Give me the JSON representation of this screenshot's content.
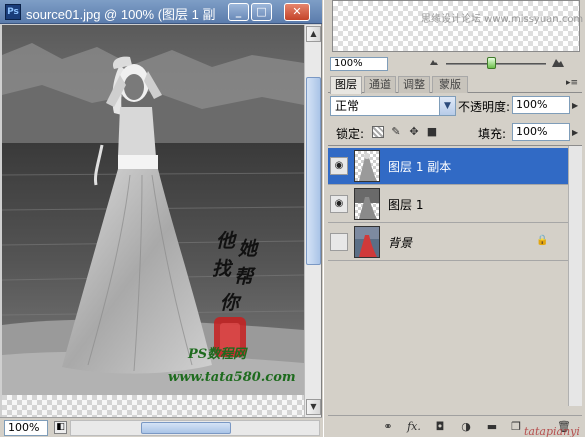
{
  "document": {
    "ps_badge": "Ps",
    "title": "source01.jpg @ 100% (图层 1 副",
    "controls": {
      "minimize": "_",
      "maximize": "□",
      "close": "✕"
    },
    "zoom": "100%",
    "artwork": {
      "calligraphy": [
        "他",
        "她",
        "找",
        "帮",
        "你"
      ],
      "site_brand": "PS数程网",
      "site_url": "www.tata580.com"
    }
  },
  "navigator": {
    "watermark": "思缘设计论坛  www.missyuan.com",
    "zoom": "100%",
    "zoom_level": 0.45
  },
  "layers_panel": {
    "tabs": [
      {
        "label": "图层",
        "active": true
      },
      {
        "label": "通道",
        "active": false
      },
      {
        "label": "调整",
        "active": false
      },
      {
        "label": "蒙版",
        "active": false
      }
    ],
    "menu_icon": "▸≡",
    "blend_mode": "正常",
    "opacity_label": "不透明度:",
    "opacity": "100%",
    "lock_label": "锁定:",
    "fill_label": "填充:",
    "fill": "100%",
    "layers": [
      {
        "name": "图层 1 副本",
        "visible": true,
        "selected": true,
        "locked": false
      },
      {
        "name": "图层 1",
        "visible": true,
        "selected": false,
        "locked": false
      },
      {
        "name": "背景",
        "visible": false,
        "selected": false,
        "locked": true
      }
    ],
    "footer_watermark": "tatapianyi"
  },
  "colors": {
    "title_bar": "#6a8ab8",
    "selection": "#316ac5",
    "panel_bg": "#d4d0c8",
    "seal_red": "#c81e1e"
  },
  "icons": {
    "eye": "👁",
    "lock": "🔒",
    "link": "⚭",
    "fx": "fx.",
    "mask": "◘",
    "adjustment": "◑",
    "folder": "▬",
    "new_layer": "❐",
    "trash": "🗑"
  }
}
